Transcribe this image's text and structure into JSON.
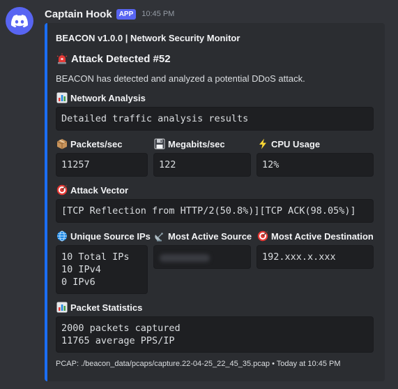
{
  "message": {
    "username": "Captain Hook",
    "badge": "APP",
    "timestamp": "10:45 PM"
  },
  "embed": {
    "accent_color": "#1b6ef3",
    "author": "BEACON v1.0.0 | Network Security Monitor",
    "title": "Attack Detected #52",
    "description": "BEACON has detected and analyzed a potential DDoS attack.",
    "fields": {
      "network_analysis": {
        "name": "Network Analysis",
        "value": "Detailed traffic analysis results"
      },
      "packets_sec": {
        "name": "Packets/sec",
        "value": "11257"
      },
      "megabits_sec": {
        "name": "Megabits/sec",
        "value": "122"
      },
      "cpu_usage": {
        "name": "CPU Usage",
        "value": "12%"
      },
      "attack_vector": {
        "name": "Attack Vector",
        "value": "[TCP Reflection from HTTP/2(50.8%)][TCP ACK(98.05%)]"
      },
      "unique_source_ips": {
        "name": "Unique Source IPs",
        "lines": [
          "10 Total IPs",
          "10 IPv4",
          "0 IPv6"
        ]
      },
      "most_active_source": {
        "name": "Most Active Source",
        "value": ""
      },
      "most_active_destination": {
        "name": "Most Active Destination",
        "value": "192.xxx.x.xxx"
      },
      "packet_statistics": {
        "name": "Packet Statistics",
        "lines": [
          "2000 packets captured",
          "11765 average PPS/IP"
        ]
      }
    },
    "footer": "PCAP: ./beacon_data/pcaps/capture.22-04-25_22_45_35.pcap • Today at 10:45 PM"
  }
}
